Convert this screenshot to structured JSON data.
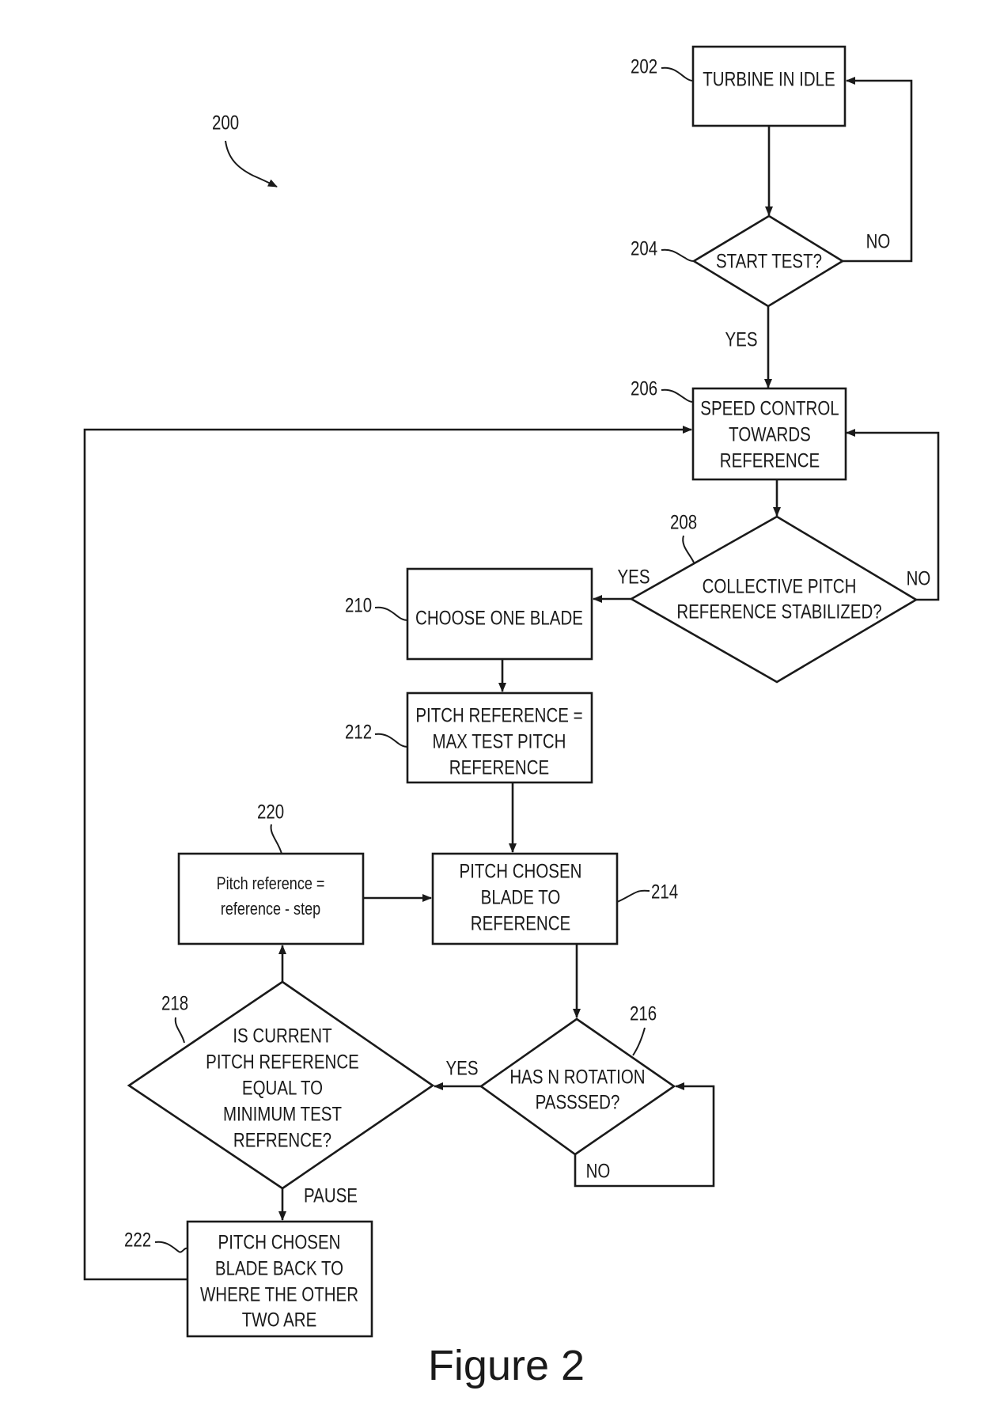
{
  "figure": {
    "diagram_ref": "200",
    "caption": "Figure 2",
    "colors": {
      "ink": "#1a1a1a",
      "background": "#ffffff"
    }
  },
  "nodes": {
    "n202": {
      "ref": "202",
      "type": "process",
      "lines": [
        "TURBINE IN IDLE"
      ]
    },
    "n204": {
      "ref": "204",
      "type": "decision",
      "lines": [
        "START TEST?"
      ]
    },
    "n206": {
      "ref": "206",
      "type": "process",
      "lines": [
        "SPEED CONTROL",
        "TOWARDS",
        "REFERENCE"
      ]
    },
    "n208": {
      "ref": "208",
      "type": "decision",
      "lines": [
        "COLLECTIVE PITCH",
        "REFERENCE STABILIZED?"
      ]
    },
    "n210": {
      "ref": "210",
      "type": "process",
      "lines": [
        "CHOOSE ONE BLADE"
      ]
    },
    "n212": {
      "ref": "212",
      "type": "process",
      "lines": [
        "PITCH REFERENCE =",
        "MAX TEST PITCH",
        "REFERENCE"
      ]
    },
    "n214": {
      "ref": "214",
      "type": "process",
      "lines": [
        "PITCH CHOSEN",
        "BLADE TO",
        "REFERENCE"
      ]
    },
    "n216": {
      "ref": "216",
      "type": "decision",
      "lines": [
        "HAS N ROTATION",
        "PASSSED?"
      ]
    },
    "n218": {
      "ref": "218",
      "type": "decision",
      "lines": [
        "IS CURRENT",
        "PITCH REFERENCE",
        "EQUAL TO",
        "MINIMUM TEST",
        "REFRENCE?"
      ]
    },
    "n220": {
      "ref": "220",
      "type": "process",
      "lines": [
        "Pitch reference =",
        "reference - step"
      ]
    },
    "n222": {
      "ref": "222",
      "type": "process",
      "lines": [
        "PITCH CHOSEN",
        "BLADE BACK TO",
        "WHERE THE OTHER",
        "TWO ARE"
      ]
    }
  },
  "edge_labels": {
    "e204_no": "NO",
    "e204_yes": "YES",
    "e208_yes": "YES",
    "e208_no": "NO",
    "e216_yes": "YES",
    "e216_no": "NO",
    "e218_pause": "PAUSE"
  },
  "edges": [
    {
      "from": "202",
      "to": "204"
    },
    {
      "from": "204",
      "to": "202",
      "label": "NO"
    },
    {
      "from": "204",
      "to": "206",
      "label": "YES"
    },
    {
      "from": "206",
      "to": "208"
    },
    {
      "from": "208",
      "to": "206",
      "label": "NO"
    },
    {
      "from": "208",
      "to": "210",
      "label": "YES"
    },
    {
      "from": "210",
      "to": "212"
    },
    {
      "from": "212",
      "to": "214"
    },
    {
      "from": "214",
      "to": "216"
    },
    {
      "from": "216",
      "to": "216",
      "label": "NO"
    },
    {
      "from": "216",
      "to": "218",
      "label": "YES"
    },
    {
      "from": "218",
      "to": "220"
    },
    {
      "from": "220",
      "to": "214"
    },
    {
      "from": "218",
      "to": "222",
      "label": "PAUSE"
    },
    {
      "from": "222",
      "to": "206"
    }
  ]
}
